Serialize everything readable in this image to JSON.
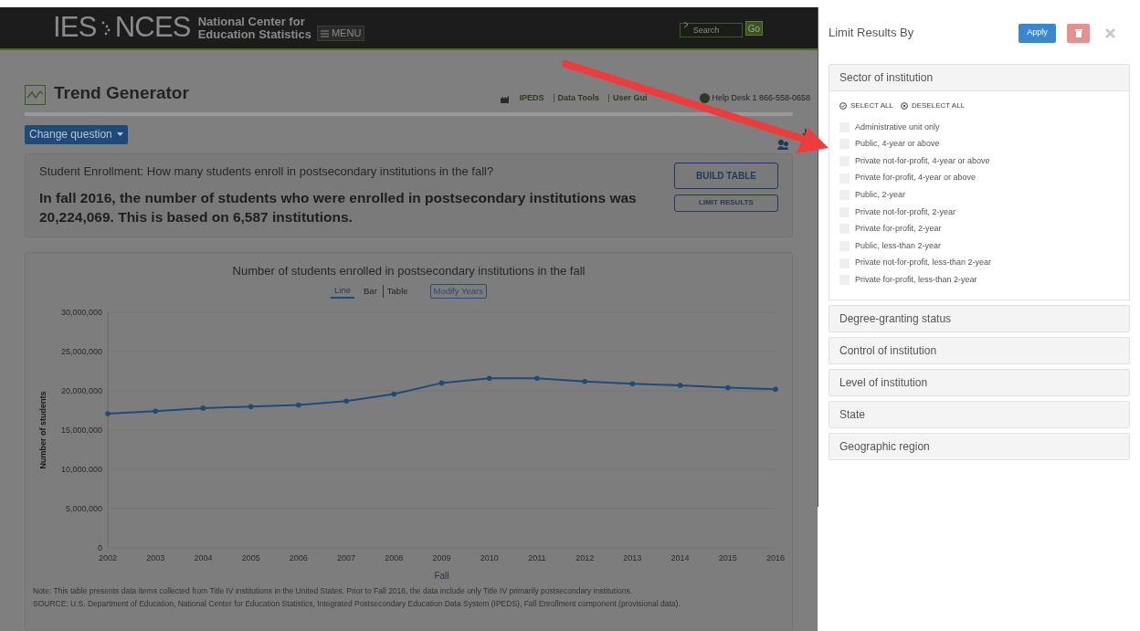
{
  "header": {
    "logo_left": "IES",
    "logo_right": "NCES",
    "org_name": [
      "National Center for",
      "Education Statistics"
    ],
    "menu": "MENU",
    "search": {
      "placeholder": "Search"
    },
    "go": "Go"
  },
  "page": {
    "title": "Trend Generator",
    "nav_links": [
      "IPEDS",
      "Data Tools",
      "User Gui"
    ],
    "help_desk": "Help Desk 1 866-558-0658",
    "change_question": "Change question"
  },
  "summary": {
    "question": "Student Enrollment: How many students enroll in postsecondary institutions in the fall?",
    "answer": "In fall 2016, the number of students who were enrolled in postsecondary institutions was 20,224,069. This is based on 6,587 institutions.",
    "buttons": [
      "BUILD TABLE",
      "LIMIT RESULTS"
    ]
  },
  "chart": {
    "views": [
      {
        "label": "Line",
        "selected": true
      },
      {
        "label": "Bar",
        "selected": false
      },
      {
        "label": "Table",
        "selected": false
      }
    ],
    "modify": "Modify Years",
    "chart_data": {
      "type": "line",
      "title": "Number of students enrolled in postsecondary institutions in the fall",
      "xlabel": "Fall",
      "ylabel": "Number of students",
      "x": [
        2002,
        2003,
        2004,
        2005,
        2006,
        2007,
        2008,
        2009,
        2010,
        2011,
        2012,
        2013,
        2014,
        2015,
        2016
      ],
      "series": [
        {
          "color": "#1f4a7a",
          "values": [
            17100000,
            17400000,
            17800000,
            18000000,
            18200000,
            18700000,
            19600000,
            21000000,
            21600000,
            21600000,
            21200000,
            20900000,
            20700000,
            20400000,
            20200000
          ]
        }
      ],
      "xlim": [
        2002,
        2016
      ],
      "ylim": [
        0,
        30000000
      ],
      "yticks": [
        {
          "value": 0,
          "label": "0"
        },
        {
          "value": 5000000,
          "label": "5,000,000"
        },
        {
          "value": 10000000,
          "label": "10,000,000"
        },
        {
          "value": 15000000,
          "label": "15,000,000"
        },
        {
          "value": 20000000,
          "label": "20,000,000"
        },
        {
          "value": 25000000,
          "label": "25,000,000"
        },
        {
          "value": 30000000,
          "label": "30,000,000"
        }
      ],
      "xticks": [
        2002,
        2003,
        2004,
        2005,
        2006,
        2007,
        2008,
        2009,
        2010,
        2011,
        2012,
        2013,
        2014,
        2015,
        2016
      ]
    },
    "notes": [
      "Note: This table presents data items collected from Title IV institutions in the United States. Prior to Fall 2016, the data include only Title IV primarily postsecondary institutions.",
      "SOURCE: U.S. Department of Education, National Center for Education Statistics, Integrated Postsecondary Education Data System (IPEDS), Fall Enrollment component (provisional data)."
    ]
  },
  "panel": {
    "title": "Limit Results By",
    "apply": "Apply",
    "select_all": "SELECT ALL",
    "deselect_all": "DESELECT ALL",
    "sections": [
      {
        "label": "Sector of institution",
        "expanded": true,
        "options": [
          {
            "label": "Administrative unit only",
            "checked": false
          },
          {
            "label": "Public, 4-year or above",
            "checked": false
          },
          {
            "label": "Private not-for-profit, 4-year or above",
            "checked": false
          },
          {
            "label": "Private for-profit, 4-year or above",
            "checked": false
          },
          {
            "label": "Public, 2-year",
            "checked": false
          },
          {
            "label": "Private not-for-profit, 2-year",
            "checked": false
          },
          {
            "label": "Private for-profit, 2-year",
            "checked": false
          },
          {
            "label": "Public, less-than 2-year",
            "checked": false
          },
          {
            "label": "Private not-for-profit, less-than 2-year",
            "checked": false
          },
          {
            "label": "Private for-profit, less-than 2-year",
            "checked": false
          }
        ]
      },
      {
        "label": "Degree-granting status",
        "expanded": false
      },
      {
        "label": "Control of institution",
        "expanded": false
      },
      {
        "label": "Level of institution",
        "expanded": false
      },
      {
        "label": "State",
        "expanded": false
      },
      {
        "label": "Geographic region",
        "expanded": false
      }
    ]
  }
}
